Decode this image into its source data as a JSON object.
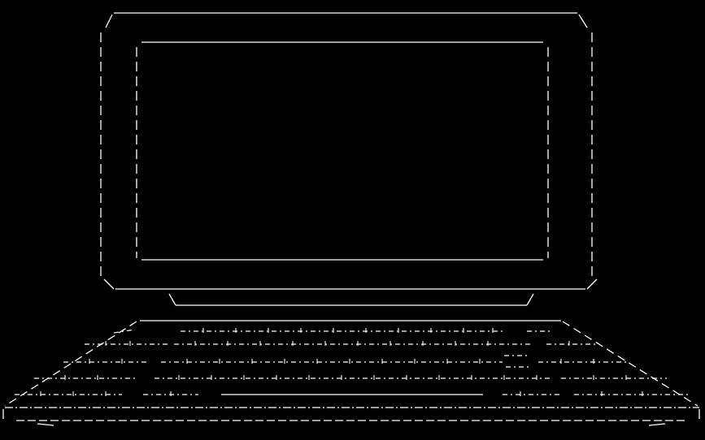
{
  "art": {
    "subject": "ascii-art-computer",
    "colors": {
      "background": "#000000",
      "line": "#ffffff"
    }
  }
}
